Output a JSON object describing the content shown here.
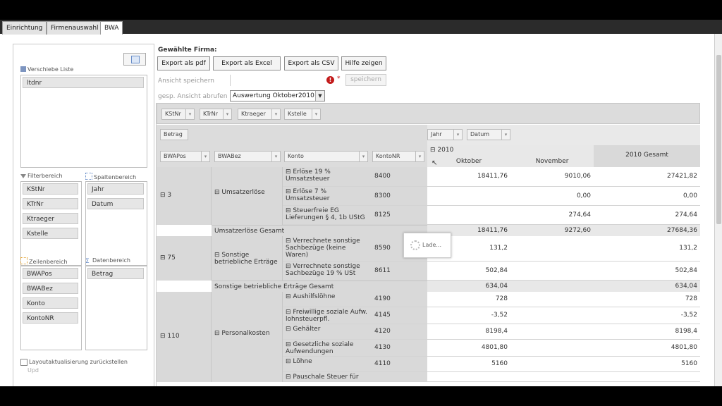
{
  "tabs": [
    "Einrichtung",
    "Firmenauswahl",
    "BWA"
  ],
  "left": {
    "row_source_title": "Verschiebe Liste",
    "row_source_items": [
      "ltdnr"
    ],
    "filter_title": "Filterbereich",
    "filter_items": [
      "KStNr",
      "KTrNr",
      "Ktraeger",
      "Kstelle"
    ],
    "col_title": "Spaltenbereich",
    "col_items": [
      "Jahr",
      "Datum"
    ],
    "rowarea_title": "Zeilenbereich",
    "rowarea_items": [
      "BWAPos",
      "BWABez",
      "Konto",
      "KontoNR"
    ],
    "data_title": "Datenbereich",
    "data_items": [
      "Betrag"
    ],
    "defer_label": "Layoutaktualisierung zurückstellen",
    "update_label": "Upd"
  },
  "toolbar": {
    "firm_label": "Gewählte Firma:",
    "buttons": [
      "Export als pdf",
      "Export als Excel",
      "Export als CSV",
      "Hilfe zeigen"
    ],
    "save_label": "Ansicht speichern",
    "save_button": "speichern",
    "load_label": "gesp. Ansicht abrufen",
    "load_select": "Auswertung Oktober2010"
  },
  "grid": {
    "filter_chips": [
      "KStNr",
      "KTrNr",
      "Ktraeger",
      "Kstelle"
    ],
    "data_field": "Betrag",
    "col_fields": [
      "Jahr",
      "Datum"
    ],
    "row_headers": [
      "BWAPos",
      "BWABez",
      "Konto",
      "KontoNR"
    ],
    "year": "2010",
    "months": [
      "Oktober",
      "November"
    ],
    "total_header": "2010 Gesamt",
    "loading": "Lade...",
    "groups": [
      {
        "pos": "3",
        "bez": "Umsatzerlöse",
        "rows": [
          {
            "konto": "Erlöse 19 % Umsatzsteuer",
            "nr": "8400",
            "okt": "18411,76",
            "nov": "9010,06",
            "tot": "27421,82"
          },
          {
            "konto": "Erlöse 7 % Umsatzsteuer",
            "nr": "8300",
            "okt": "",
            "nov": "0,00",
            "tot": "0,00"
          },
          {
            "konto": "Steuerfreie EG Lieferungen § 4, 1b UStG",
            "nr": "8125",
            "okt": "",
            "nov": "274,64",
            "tot": "274,64"
          }
        ],
        "total_label": "Umsatzerlöse Gesamt",
        "total": {
          "okt": "18411,76",
          "nov": "9272,60",
          "tot": "27684,36"
        }
      },
      {
        "pos": "75",
        "bez": "Sonstige betriebliche Erträge",
        "rows": [
          {
            "konto": "Verrechnete sonstige Sachbezüge (keine Waren)",
            "nr": "8590",
            "okt": "131,2",
            "nov": "",
            "tot": "131,2"
          },
          {
            "konto": "Verrechnete sonstige Sachbezüge 19 % USt",
            "nr": "8611",
            "okt": "502,84",
            "nov": "",
            "tot": "502,84"
          }
        ],
        "total_label": "Sonstige betriebliche Erträge Gesamt",
        "total": {
          "okt": "634,04",
          "nov": "",
          "tot": "634,04"
        }
      },
      {
        "pos": "110",
        "bez": "Personalkosten",
        "rows": [
          {
            "konto": "Aushilfslöhne",
            "nr": "4190",
            "okt": "728",
            "nov": "",
            "tot": "728"
          },
          {
            "konto": "Freiwillige soziale Aufw. lohnsteuerpfl.",
            "nr": "4145",
            "okt": "-3,52",
            "nov": "",
            "tot": "-3,52"
          },
          {
            "konto": "Gehälter",
            "nr": "4120",
            "okt": "8198,4",
            "nov": "",
            "tot": "8198,4"
          },
          {
            "konto": "Gesetzliche soziale Aufwendungen",
            "nr": "4130",
            "okt": "4801,80",
            "nov": "",
            "tot": "4801,80"
          },
          {
            "konto": "Löhne",
            "nr": "4110",
            "okt": "5160",
            "nov": "",
            "tot": "5160"
          },
          {
            "konto": "Pauschale Steuer für",
            "nr": "",
            "okt": "",
            "nov": "",
            "tot": ""
          }
        ]
      }
    ]
  }
}
